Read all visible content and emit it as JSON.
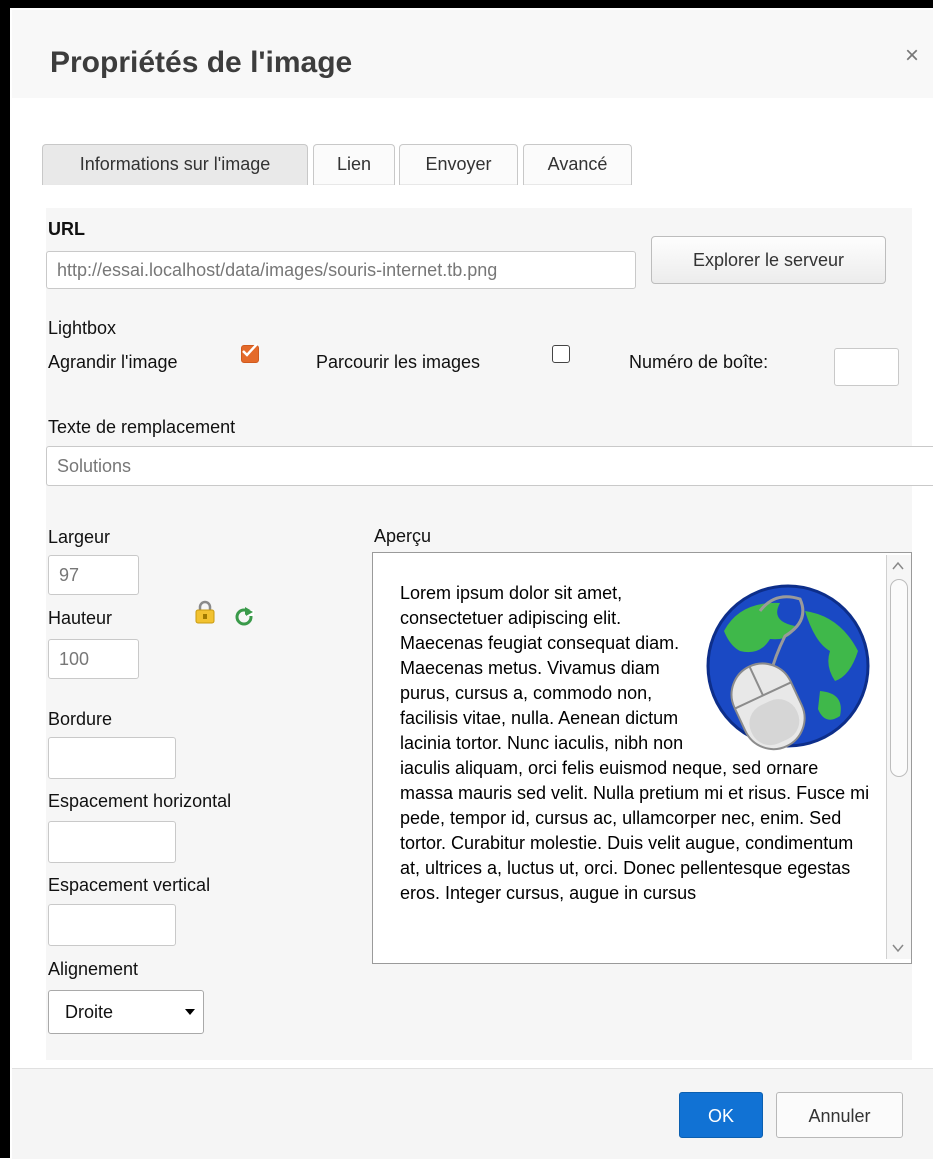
{
  "dialog": {
    "title": "Propriétés de l'image",
    "close_symbol": "×"
  },
  "tabs": [
    {
      "label": "Informations sur l'image",
      "active": true
    },
    {
      "label": "Lien",
      "active": false
    },
    {
      "label": "Envoyer",
      "active": false
    },
    {
      "label": "Avancé",
      "active": false
    }
  ],
  "url": {
    "label": "URL",
    "value": "http://essai.localhost/data/images/souris-internet.tb.png",
    "browse_button": "Explorer le serveur"
  },
  "lightbox": {
    "label": "Lightbox",
    "enlarge_label": "Agrandir l'image",
    "enlarge_checked": true,
    "browse_label": "Parcourir les images",
    "browse_checked": false,
    "box_number_label": "Numéro de boîte:",
    "box_number_value": ""
  },
  "alt_text": {
    "label": "Texte de remplacement",
    "value": "Solutions"
  },
  "dimensions": {
    "width_label": "Largeur",
    "width_value": "97",
    "height_label": "Hauteur",
    "height_value": "100",
    "lock_icon": "lock-icon",
    "reset_icon": "reset-size-icon"
  },
  "border": {
    "label": "Bordure",
    "value": ""
  },
  "hspace": {
    "label": "Espacement horizontal",
    "value": ""
  },
  "vspace": {
    "label": "Espacement vertical",
    "value": ""
  },
  "alignment": {
    "label": "Alignement",
    "value": "Droite"
  },
  "preview": {
    "label": "Aperçu",
    "text": "Lorem ipsum dolor sit amet, consectetuer adipiscing elit. Maecenas feugiat consequat diam. Maecenas metus. Vivamus diam purus, cursus a, commodo non, facilisis vitae, nulla. Aenean dictum lacinia tortor. Nunc iaculis, nibh non iaculis aliquam, orci felis euismod neque, sed ornare massa mauris sed velit. Nulla pretium mi et risus. Fusce mi pede, tempor id, cursus ac, ullamcorper nec, enim. Sed tortor. Curabitur molestie. Duis velit augue, condimentum at, ultrices a, luctus ut, orci. Donec pellentesque egestas eros. Integer cursus, augue in cursus"
  },
  "footer": {
    "ok_label": "OK",
    "cancel_label": "Annuler"
  },
  "colors": {
    "accent": "#1172d4",
    "checkbox_checked": "#e46a2a"
  }
}
